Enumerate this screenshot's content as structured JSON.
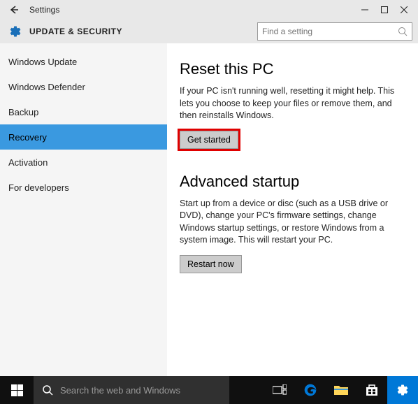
{
  "titlebar": {
    "title": "Settings"
  },
  "subheader": {
    "title": "UPDATE & SECURITY"
  },
  "search": {
    "placeholder": "Find a setting"
  },
  "sidebar": {
    "items": [
      {
        "label": "Windows Update",
        "selected": false
      },
      {
        "label": "Windows Defender",
        "selected": false
      },
      {
        "label": "Backup",
        "selected": false
      },
      {
        "label": "Recovery",
        "selected": true
      },
      {
        "label": "Activation",
        "selected": false
      },
      {
        "label": "For developers",
        "selected": false
      }
    ]
  },
  "main": {
    "sections": [
      {
        "title": "Reset this PC",
        "desc": "If your PC isn't running well, resetting it might help. This lets you choose to keep your files or remove them, and then reinstalls Windows.",
        "button": "Get started",
        "highlight": true
      },
      {
        "title": "Advanced startup",
        "desc": "Start up from a device or disc (such as a USB drive or DVD), change your PC's firmware settings, change Windows startup settings, or restore Windows from a system image. This will restart your PC.",
        "button": "Restart now",
        "highlight": false
      }
    ]
  },
  "taskbar": {
    "search_text": "Search the web and Windows"
  }
}
